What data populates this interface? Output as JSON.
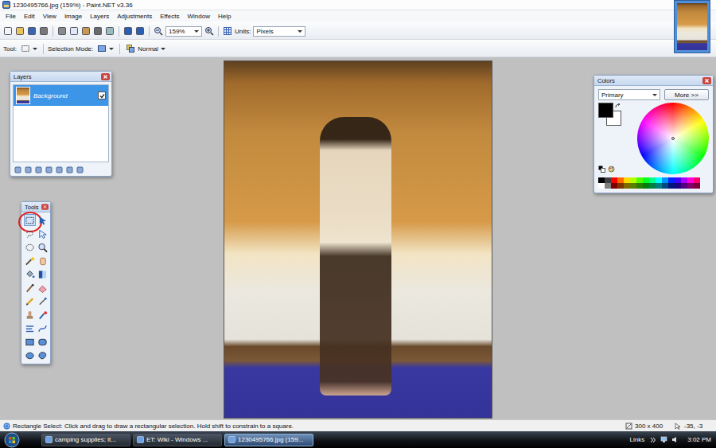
{
  "window": {
    "title": "1230495766.jpg (159%) - Paint.NET v3.36"
  },
  "menu": [
    "File",
    "Edit",
    "View",
    "Image",
    "Layers",
    "Adjustments",
    "Effects",
    "Window",
    "Help"
  ],
  "toolbar": {
    "zoom": "159%",
    "units_label": "Units:",
    "units": "Pixels"
  },
  "tool_options": {
    "tool_label": "Tool:",
    "selection_mode_label": "Selection Mode:",
    "blend_mode": "Normal"
  },
  "layers_panel": {
    "title": "Layers",
    "layers": [
      {
        "name": "Background",
        "selected": true,
        "visible": true
      }
    ]
  },
  "tools_panel": {
    "title": "Tools",
    "tools": [
      {
        "kind": "rect-select",
        "selected": true,
        "circled": true
      },
      {
        "kind": "move",
        "selected": false,
        "circled": false
      },
      {
        "kind": "lasso",
        "selected": false,
        "circled": false
      },
      {
        "kind": "move-selection",
        "selected": false,
        "circled": false
      },
      {
        "kind": "ellipse-select",
        "selected": false,
        "circled": false
      },
      {
        "kind": "zoom",
        "selected": false,
        "circled": false
      },
      {
        "kind": "magic-wand",
        "selected": false,
        "circled": false
      },
      {
        "kind": "pan",
        "selected": false,
        "circled": false
      },
      {
        "kind": "bucket",
        "selected": false,
        "circled": false
      },
      {
        "kind": "gradient",
        "selected": false,
        "circled": false
      },
      {
        "kind": "paintbrush",
        "selected": false,
        "circled": false
      },
      {
        "kind": "eraser",
        "selected": false,
        "circled": false
      },
      {
        "kind": "pencil",
        "selected": false,
        "circled": false
      },
      {
        "kind": "color-picker",
        "selected": false,
        "circled": false
      },
      {
        "kind": "clone",
        "selected": false,
        "circled": false
      },
      {
        "kind": "recolor",
        "selected": false,
        "circled": false
      },
      {
        "kind": "text",
        "selected": false,
        "circled": false
      },
      {
        "kind": "line",
        "selected": false,
        "circled": false
      },
      {
        "kind": "rectangle",
        "selected": false,
        "circled": false
      },
      {
        "kind": "rounded-rectangle",
        "selected": false,
        "circled": false
      },
      {
        "kind": "ellipse",
        "selected": false,
        "circled": false
      },
      {
        "kind": "freeform",
        "selected": false,
        "circled": false
      }
    ]
  },
  "colors_panel": {
    "title": "Colors",
    "mode": "Primary",
    "more_button": "More >>",
    "primary": "#000000",
    "secondary": "#ffffff",
    "palette": [
      {
        "color": "#000000"
      },
      {
        "color": "#404040"
      },
      {
        "color": "#ff0000"
      },
      {
        "color": "#ff6a00"
      },
      {
        "color": "#ffd800"
      },
      {
        "color": "#b6ff00"
      },
      {
        "color": "#4cff00"
      },
      {
        "color": "#00ff21"
      },
      {
        "color": "#00ff90"
      },
      {
        "color": "#00ffff"
      },
      {
        "color": "#0094ff"
      },
      {
        "color": "#0026ff"
      },
      {
        "color": "#4800ff"
      },
      {
        "color": "#b200ff"
      },
      {
        "color": "#ff00dc"
      },
      {
        "color": "#ff006e"
      },
      {
        "color": "#ffffff"
      },
      {
        "color": "#808080"
      },
      {
        "color": "#7f0000"
      },
      {
        "color": "#7f3300"
      },
      {
        "color": "#7f6a00"
      },
      {
        "color": "#5b7f00"
      },
      {
        "color": "#267f00"
      },
      {
        "color": "#007f0e"
      },
      {
        "color": "#007f46"
      },
      {
        "color": "#007f7f"
      },
      {
        "color": "#004a7f"
      },
      {
        "color": "#00137f"
      },
      {
        "color": "#21007f"
      },
      {
        "color": "#57007f"
      },
      {
        "color": "#7f006e"
      },
      {
        "color": "#7f0037"
      }
    ]
  },
  "status_bar": {
    "hint": "Rectangle Select: Click and drag to draw a rectangular selection. Hold shift to constrain to a square.",
    "image_size": "300 x 400",
    "cursor": "-35, -3"
  },
  "taskbar": {
    "tasks": [
      {
        "label": "camping supplies; it...",
        "selected": false
      },
      {
        "label": "ET: Wiki - Windows ...",
        "selected": false
      },
      {
        "label": "1230495766.jpg (159...",
        "selected": true
      }
    ],
    "links": "Links",
    "clock": "3:02 PM"
  }
}
